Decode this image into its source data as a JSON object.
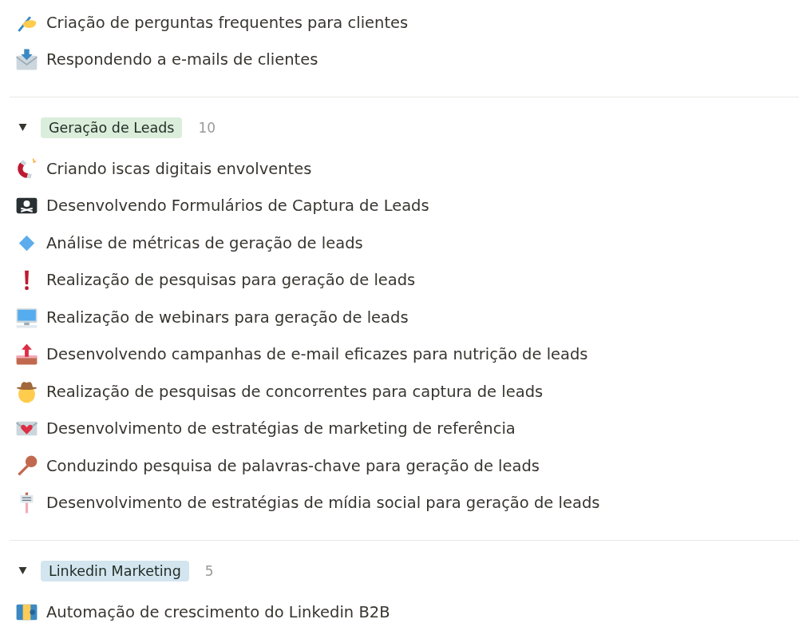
{
  "sections": [
    {
      "items": [
        {
          "kind": "writing",
          "title": "Criação de perguntas frequentes para clientes"
        },
        {
          "kind": "inbox",
          "title": "Respondendo a e-mails de clientes"
        }
      ]
    },
    {
      "group": {
        "label": "Geração de Leads",
        "color": "#dbeddb",
        "count": "10",
        "expanded": true
      },
      "items": [
        {
          "kind": "magnet",
          "title": "Criando iscas digitais envolventes"
        },
        {
          "kind": "pirate",
          "title": "Desenvolvendo Formulários de Captura de Leads"
        },
        {
          "kind": "diamond",
          "title": "Análise de métricas de geração de leads"
        },
        {
          "kind": "exclamation",
          "title": "Realização de pesquisas para geração de leads"
        },
        {
          "kind": "computer",
          "title": "Realização de webinars para geração de leads"
        },
        {
          "kind": "outbox",
          "title": "Desenvolvendo campanhas de e-mail eficazes para nutrição de leads"
        },
        {
          "kind": "cowboy",
          "title": "Realização de pesquisas de concorrentes para captura de leads"
        },
        {
          "kind": "loveletter",
          "title": "Desenvolvimento de estratégias de marketing de referência"
        },
        {
          "kind": "key",
          "title": "Conduzindo pesquisa de palavras-chave para geração de leads"
        },
        {
          "kind": "sign",
          "title": "Desenvolvimento de estratégias de mídia social para geração de leads"
        }
      ]
    },
    {
      "group": {
        "label": "Linkedin Marketing",
        "color": "#d3e5ef",
        "count": "5",
        "expanded": true
      },
      "items": [
        {
          "kind": "banknote",
          "title": "Automação de crescimento do Linkedin B2B"
        }
      ]
    }
  ]
}
